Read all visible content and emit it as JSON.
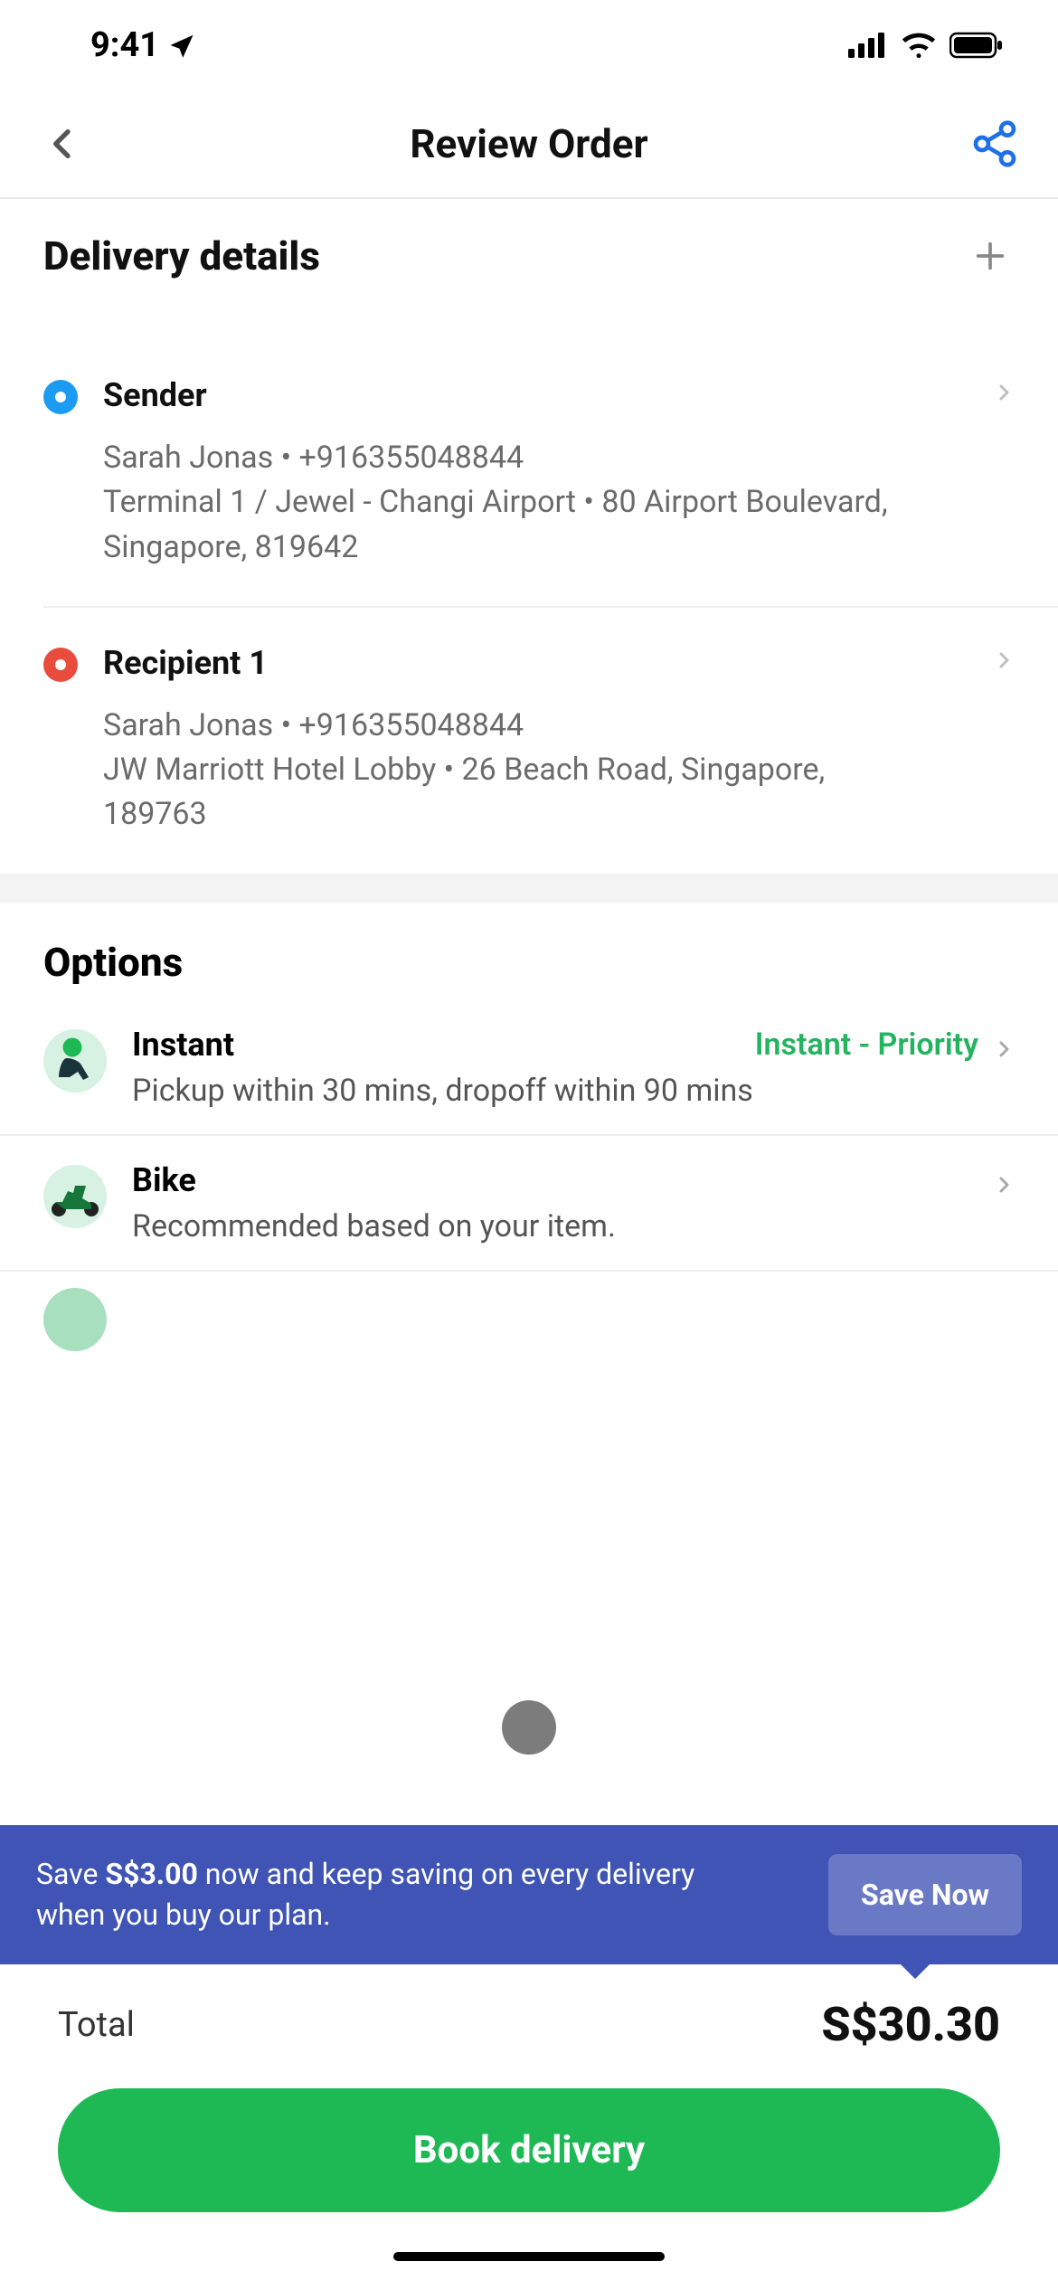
{
  "status": {
    "time": "9:41"
  },
  "nav": {
    "title": "Review Order"
  },
  "delivery": {
    "title": "Delivery details",
    "sender": {
      "label": "Sender",
      "contact": "Sarah Jonas • +916355048844",
      "address": "Terminal 1 / Jewel - Changi Airport • 80 Airport Boulevard, Singapore, 819642"
    },
    "recipient": {
      "label": "Recipient 1",
      "contact": "Sarah Jonas • +916355048844",
      "address": "JW Marriott Hotel Lobby • 26 Beach Road, Singapore, 189763"
    }
  },
  "options": {
    "title": "Options",
    "instant": {
      "name": "Instant",
      "tag": "Instant - Priority",
      "desc": "Pickup within 30 mins, dropoff within 90 mins"
    },
    "vehicle": {
      "name": "Bike",
      "desc": "Recommended based on your item."
    }
  },
  "promo": {
    "text_prefix": "Save ",
    "amount": "S$3.00",
    "text_suffix": " now and keep saving on every delivery when you buy our plan.",
    "button": "Save Now"
  },
  "footer": {
    "total_label": "Total",
    "total_value": "S$30.30",
    "cta": "Book delivery"
  }
}
